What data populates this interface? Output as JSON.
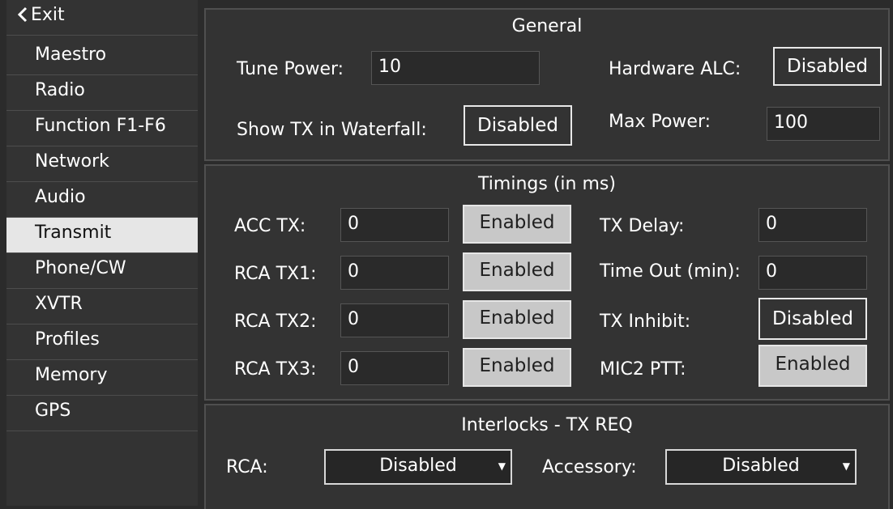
{
  "sidebar": {
    "exit_label": "Exit",
    "items": [
      {
        "label": "Maestro"
      },
      {
        "label": "Radio"
      },
      {
        "label": "Function F1-F6"
      },
      {
        "label": "Network"
      },
      {
        "label": "Audio"
      },
      {
        "label": "Transmit",
        "active": true
      },
      {
        "label": "Phone/CW"
      },
      {
        "label": "XVTR"
      },
      {
        "label": "Profiles"
      },
      {
        "label": "Memory"
      },
      {
        "label": "GPS"
      }
    ]
  },
  "general": {
    "title": "General",
    "tune_power_label": "Tune Power:",
    "tune_power_value": "10",
    "hardware_alc_label": "Hardware ALC:",
    "hardware_alc_value": "Disabled",
    "show_tx_label": "Show TX in Waterfall:",
    "show_tx_value": "Disabled",
    "max_power_label": "Max Power:",
    "max_power_value": "100"
  },
  "timings": {
    "title": "Timings (in ms)",
    "rows": [
      {
        "label": "ACC TX:",
        "value": "0",
        "state": "Enabled"
      },
      {
        "label": "RCA TX1:",
        "value": "0",
        "state": "Enabled"
      },
      {
        "label": "RCA TX2:",
        "value": "0",
        "state": "Enabled"
      },
      {
        "label": "RCA TX3:",
        "value": "0",
        "state": "Enabled"
      }
    ],
    "tx_delay_label": "TX Delay:",
    "tx_delay_value": "0",
    "time_out_label": "Time Out (min):",
    "time_out_value": "0",
    "tx_inhibit_label": "TX Inhibit:",
    "tx_inhibit_value": "Disabled",
    "mic2_ptt_label": "MIC2 PTT:",
    "mic2_ptt_value": "Enabled"
  },
  "interlocks": {
    "title": "Interlocks - TX REQ",
    "rca_label": "RCA:",
    "rca_value": "Disabled",
    "accessory_label": "Accessory:",
    "accessory_value": "Disabled"
  },
  "colors": {
    "background": "#2b2b2b",
    "panel": "#333333",
    "active_item": "#e6e6e6",
    "enabled_button": "#c8c8c8"
  },
  "icons": {
    "exit": "chevron-left-icon",
    "dropdown": "caret-down-icon"
  }
}
